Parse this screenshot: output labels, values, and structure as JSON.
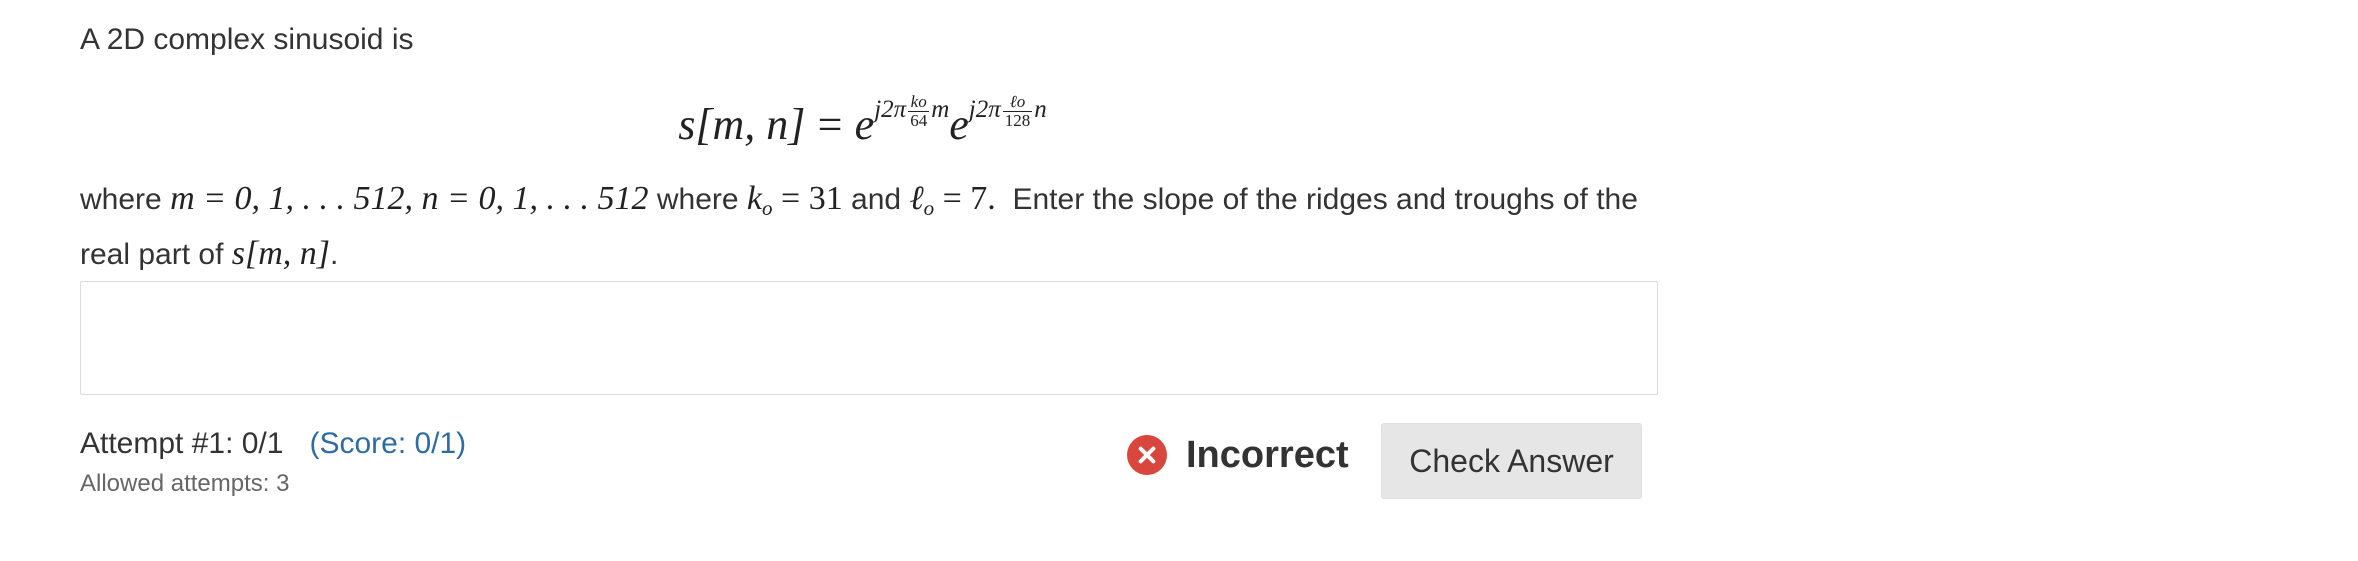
{
  "question": {
    "intro": "A 2D complex sinusoid is",
    "equation": {
      "lhs": "s[m, n]",
      "equals": "=",
      "base": "e",
      "exp1_prefix": "j2π",
      "frac1_num": "ko",
      "frac1_den": "64",
      "exp1_var": "m",
      "exp2_prefix": "j2π",
      "frac2_num": "ℓo",
      "frac2_den": "128",
      "exp2_var": "n"
    },
    "paragraph": {
      "where1": "where",
      "m_range": "m = 0, 1, . . . 512, n = 0, 1, . . . 512",
      "where2": "where",
      "k_sym": "k",
      "k_sub": "o",
      "k_val": " = 31",
      "and": "and",
      "l_sym": "ℓ",
      "l_sub": "o",
      "l_val": " = 7.",
      "instruction": "Enter the slope of the ridges and troughs of the real part of",
      "expr": "s[m, n]",
      "end": "."
    }
  },
  "answer": {
    "value": ""
  },
  "attempt": {
    "label": "Attempt #1: 0/1",
    "score": "(Score: 0/1)",
    "allowed": "Allowed attempts: 3"
  },
  "status": {
    "text": "Incorrect",
    "color": "#d9463e",
    "icon": "x-circle-icon"
  },
  "buttons": {
    "check_label": "Check Answer"
  }
}
